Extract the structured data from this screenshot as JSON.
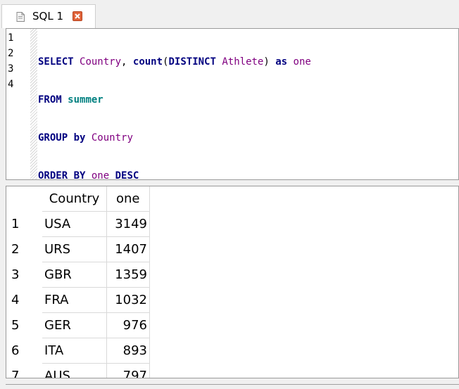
{
  "tab": {
    "label": "SQL 1"
  },
  "editor": {
    "line_numbers": [
      "1",
      "2",
      "3",
      "4"
    ],
    "lines": [
      [
        "SELECT",
        " ",
        "Country",
        ", ",
        "count",
        "(",
        "DISTINCT",
        " ",
        "Athlete",
        ") ",
        "as",
        " ",
        "one"
      ],
      [
        "FROM",
        " ",
        "summer"
      ],
      [
        "GROUP by",
        " ",
        "Country"
      ],
      [
        "ORDER BY",
        " ",
        "one",
        " ",
        "DESC"
      ]
    ]
  },
  "results": {
    "columns": [
      "Country",
      "one"
    ],
    "rows": [
      {
        "num": "1",
        "country": "USA",
        "one": "3149"
      },
      {
        "num": "2",
        "country": "URS",
        "one": "1407"
      },
      {
        "num": "3",
        "country": "GBR",
        "one": "1359"
      },
      {
        "num": "4",
        "country": "FRA",
        "one": "1032"
      },
      {
        "num": "5",
        "country": "GER",
        "one": "976"
      },
      {
        "num": "6",
        "country": "ITA",
        "one": "893"
      },
      {
        "num": "7",
        "country": "AUS",
        "one": "797"
      }
    ]
  },
  "colors": {
    "keyword": "#000080",
    "identifier": "#800080",
    "table": "#008080",
    "close_button": "#e0633a"
  },
  "icons": {
    "tab": "sql-file-icon",
    "close": "close-icon"
  }
}
